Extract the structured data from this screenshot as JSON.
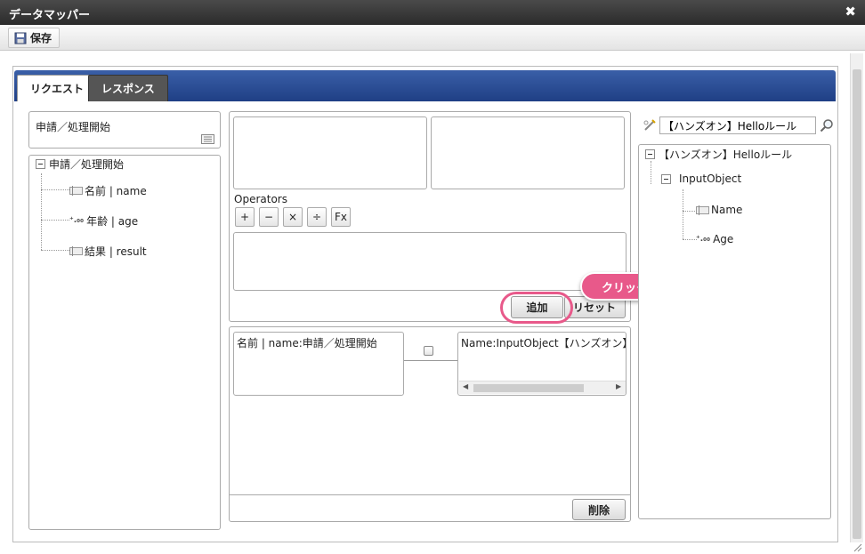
{
  "window": {
    "title": "データマッパー",
    "close_glyph": "✖"
  },
  "toolbar": {
    "save_label": "保存"
  },
  "tabs": {
    "request": "リクエスト",
    "response": "レスポンス"
  },
  "left": {
    "header": "申請／処理開始",
    "tree": {
      "root": "申請／処理開始",
      "children": [
        "名前 | name",
        "年齢 | age",
        "結果 | result"
      ]
    }
  },
  "center": {
    "operators_label": "Operators",
    "operators": [
      "+",
      "−",
      "×",
      "÷",
      "Fx"
    ],
    "add_label": "追加",
    "reset_label": "リセット",
    "mapping": {
      "source": "名前 | name:申請／処理開始",
      "target": "Name:InputObject【ハンズオン】Hel"
    },
    "delete_label": "削除"
  },
  "right": {
    "search_value": "【ハンズオン】Helloルール",
    "tree": {
      "root": "【ハンズオン】Helloルール",
      "object": "InputObject",
      "children": [
        "Name",
        "Age"
      ]
    }
  },
  "callout": {
    "label": "クリック"
  },
  "colors": {
    "accent": "#e8598a",
    "tab_bar": "#2a4d95",
    "titlebar": "#333333"
  },
  "icons": {
    "num_glyph": "⁺.₀₀"
  }
}
